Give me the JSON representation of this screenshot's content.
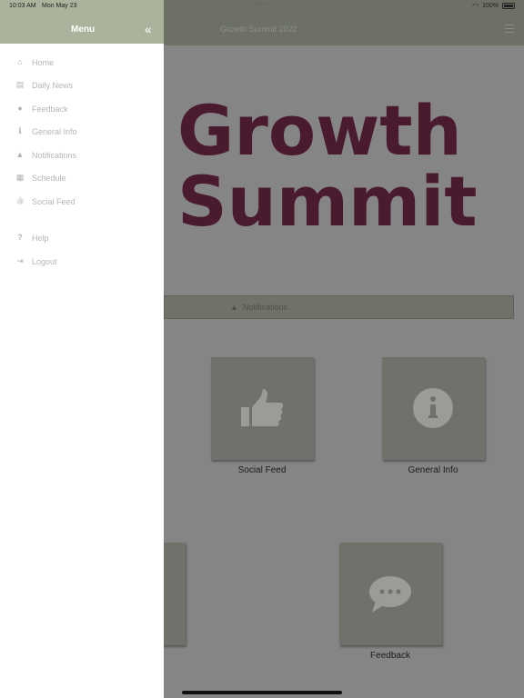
{
  "status_bar": {
    "time": "10:03 AM",
    "date": "Mon May 23",
    "battery": "100%"
  },
  "app": {
    "title": "Growth Summit 2022",
    "hero_line1": "Growth",
    "hero_line2": "Summit",
    "notifications_label": "Notifications",
    "tiles": [
      {
        "label": "Social Feed",
        "icon": "thumbs-up-icon"
      },
      {
        "label": "General Info",
        "icon": "info-icon"
      },
      {
        "label": "Feedback",
        "icon": "chat-bubble-icon"
      }
    ]
  },
  "drawer": {
    "title": "Menu",
    "items": [
      {
        "label": "Home",
        "icon": "home-icon",
        "glyph": "⌂"
      },
      {
        "label": "Daily News",
        "icon": "newspaper-icon",
        "glyph": "▤"
      },
      {
        "label": "Feedback",
        "icon": "comment-icon",
        "glyph": "●"
      },
      {
        "label": "General Info",
        "icon": "info-circle-icon",
        "glyph": "ℹ"
      },
      {
        "label": "Notifications",
        "icon": "bell-icon",
        "glyph": "▲"
      },
      {
        "label": "Schedule",
        "icon": "calendar-icon",
        "glyph": "▦"
      },
      {
        "label": "Social Feed",
        "icon": "thumbs-up-icon",
        "glyph": "👍"
      },
      {
        "label": "Help",
        "icon": "question-icon",
        "glyph": "?"
      },
      {
        "label": "Logout",
        "icon": "logout-icon",
        "glyph": "⇥"
      }
    ]
  },
  "colors": {
    "drawer_header": "#aab39b",
    "app_header": "#6c7065",
    "hero_text": "#4a1a2e",
    "tile": "#6f726a"
  }
}
